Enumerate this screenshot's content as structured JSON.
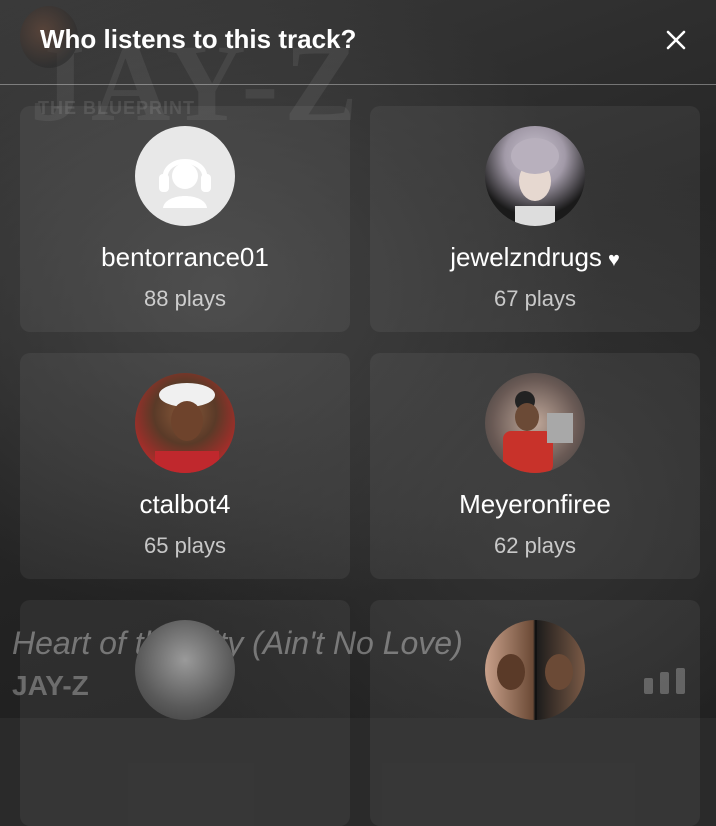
{
  "modal": {
    "title": "Who listens to this track?"
  },
  "background": {
    "album_text": "JAY-Z",
    "album_sub": "THE BLUEPRINT",
    "now_playing_title": "Heart of the City (Ain't No Love)",
    "now_playing_artist": "JAY-Z"
  },
  "listeners": [
    {
      "username": "bentorrance01",
      "plays": "88 plays",
      "avatar": "default-headphones"
    },
    {
      "username": "jewelzndrugs",
      "plays": "67 plays",
      "avatar": "photo",
      "loved": true
    },
    {
      "username": "ctalbot4",
      "plays": "65 plays",
      "avatar": "photo"
    },
    {
      "username": "Meyeronfiree",
      "plays": "62 plays",
      "avatar": "photo"
    },
    {
      "username": "",
      "plays": "",
      "avatar": "photo"
    },
    {
      "username": "",
      "plays": "",
      "avatar": "photo"
    }
  ],
  "colors": {
    "accent": "#ffffff",
    "card_bg": "rgba(255,255,255,0.06)",
    "muted_text": "rgba(255,255,255,0.72)"
  },
  "icons": {
    "close": "close-icon",
    "love": "heart-icon",
    "default_avatar": "headphones-user-icon"
  }
}
